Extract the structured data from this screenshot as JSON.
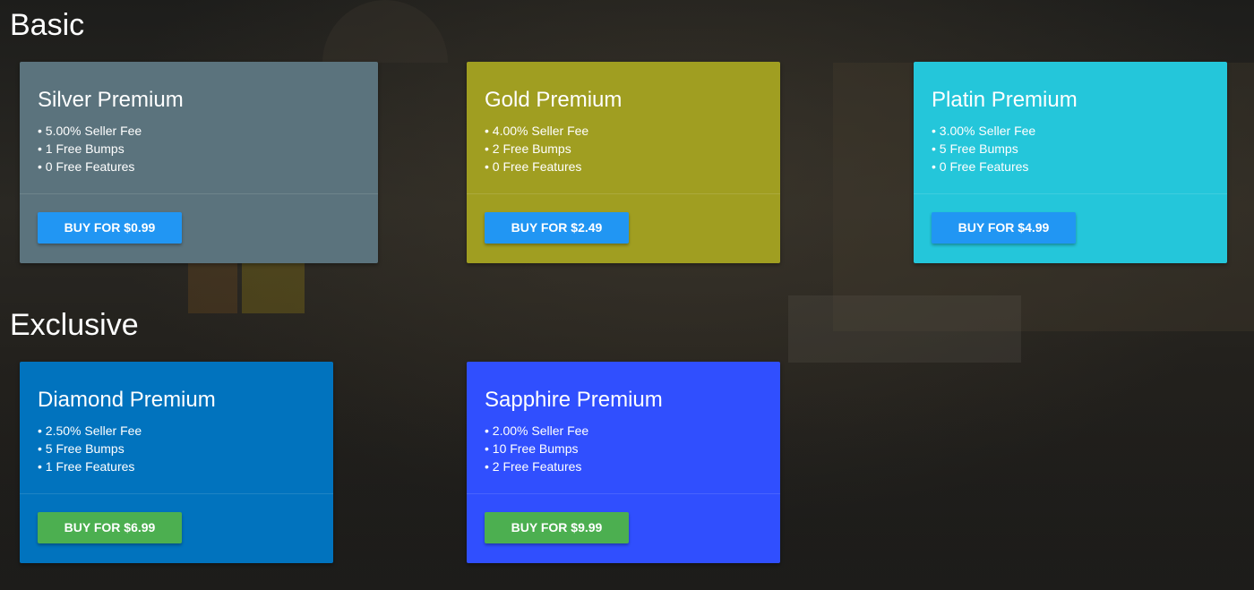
{
  "sections": [
    {
      "title": "Basic",
      "cards": [
        {
          "name": "Silver Premium",
          "features": [
            "5.00% Seller Fee",
            "1 Free Bumps",
            "0 Free Features"
          ],
          "button": "BUY FOR $0.99",
          "color": "#5b737d",
          "button_color": "#2196f3"
        },
        {
          "name": "Gold Premium",
          "features": [
            "4.00% Seller Fee",
            "2 Free Bumps",
            "0 Free Features"
          ],
          "button": "BUY FOR $2.49",
          "color": "#a09e21",
          "button_color": "#2196f3"
        },
        {
          "name": "Platin Premium",
          "features": [
            "3.00% Seller Fee",
            "5 Free Bumps",
            "0 Free Features"
          ],
          "button": "BUY FOR $4.99",
          "color": "#24c6da",
          "button_color": "#2196f3"
        }
      ]
    },
    {
      "title": "Exclusive",
      "cards": [
        {
          "name": "Diamond Premium",
          "features": [
            "2.50% Seller Fee",
            "5 Free Bumps",
            "1 Free Features"
          ],
          "button": "BUY FOR $6.99",
          "color": "#0173be",
          "button_color": "#4caf50"
        },
        {
          "name": "Sapphire Premium",
          "features": [
            "2.00% Seller Fee",
            "10 Free Bumps",
            "2 Free Features"
          ],
          "button": "BUY FOR $9.99",
          "color": "#304ffe",
          "button_color": "#4caf50"
        }
      ]
    }
  ]
}
